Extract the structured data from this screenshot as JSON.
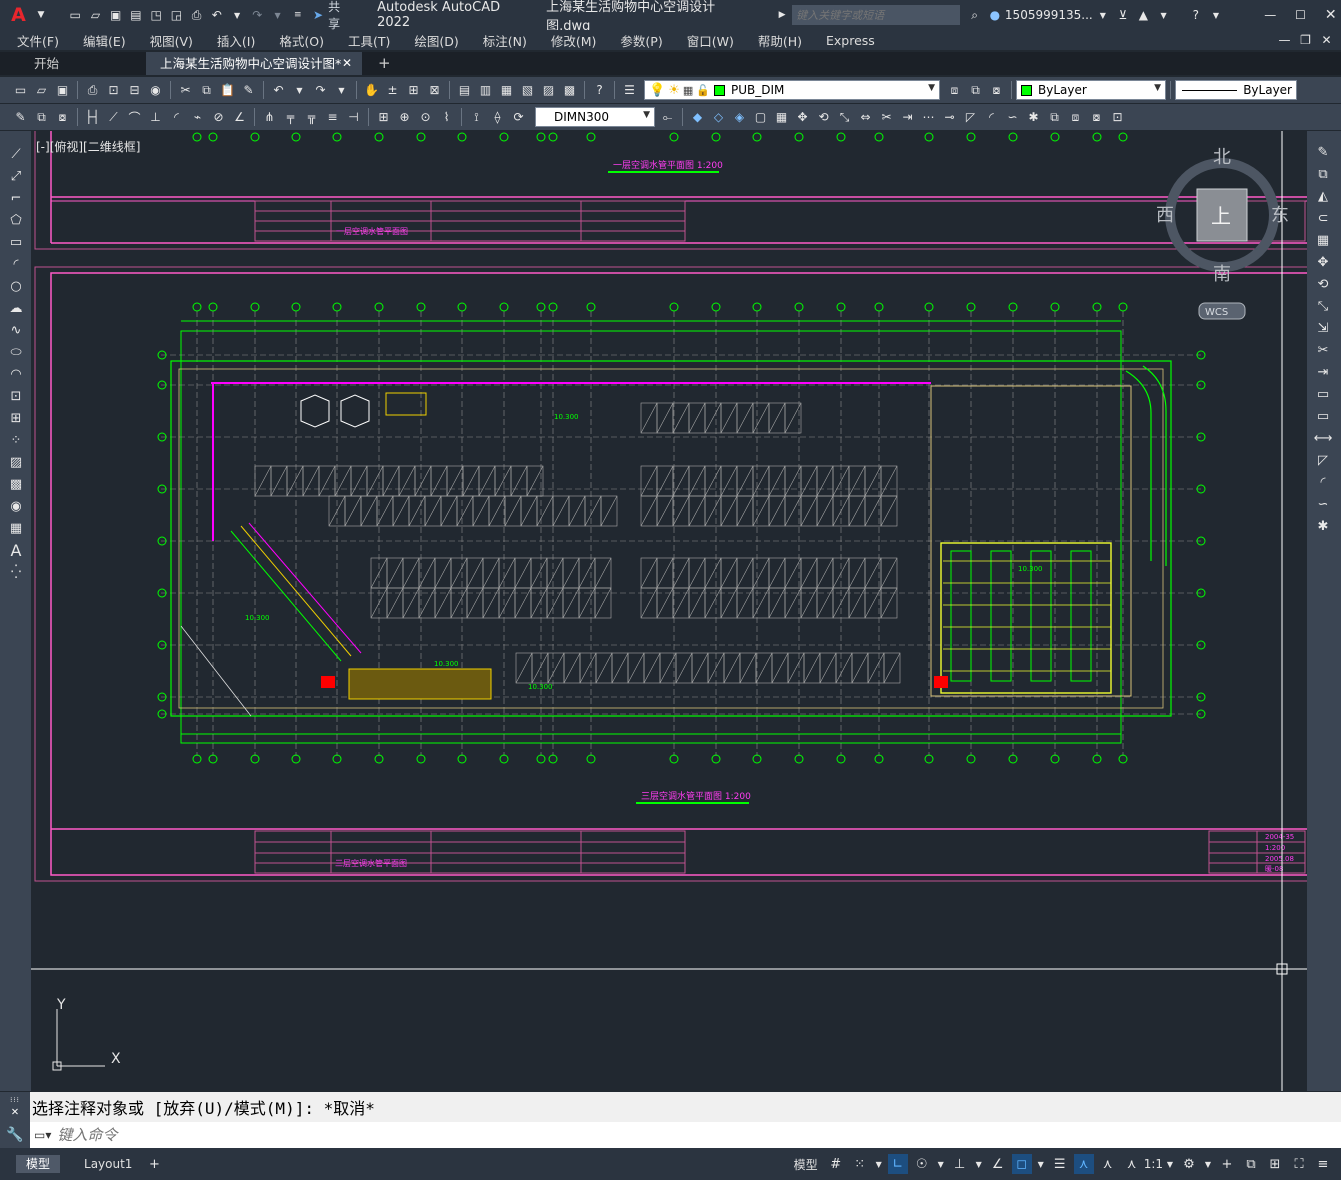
{
  "app": {
    "logo": "A",
    "title": "Autodesk AutoCAD 2022",
    "filename": "上海某生活购物中心空调设计图.dwg",
    "share_label": "共享",
    "search_placeholder": "键入关键字或短语",
    "user": "1505999135...",
    "colors": {
      "accent": "#c8102e",
      "title_bg": "#2b3440",
      "toolbar_bg": "#3b4553",
      "canvas_bg": "#212830",
      "layer_green": "#00ff00",
      "magenta": "#ff00ff"
    }
  },
  "menu": [
    "文件(F)",
    "编辑(E)",
    "视图(V)",
    "插入(I)",
    "格式(O)",
    "工具(T)",
    "绘图(D)",
    "标注(N)",
    "修改(M)",
    "参数(P)",
    "窗口(W)",
    "帮助(H)",
    "Express"
  ],
  "tabs": [
    {
      "label": "开始"
    },
    {
      "label": "上海某生活购物中心空调设计图*"
    }
  ],
  "toolbar": {
    "layer_name": "PUB_DIM",
    "color_value": "ByLayer",
    "linetype_value": "ByLayer",
    "dimstyle_value": "DIMN300"
  },
  "viewport": {
    "label": "[-][俯视][二维线框]",
    "compass": {
      "north": "北",
      "south": "南",
      "east": "东",
      "west": "西",
      "top": "上",
      "wcs": "WCS"
    },
    "ucs": {
      "x": "X",
      "y": "Y"
    }
  },
  "drawing": {
    "title_top": "一层空调水管平面图 1:200",
    "title_main": "三层空调水管平面图 1:200",
    "titleblock_top": "一层空调水管平面图",
    "titleblock_main": "三层空调水管平面图",
    "tb_right": [
      "2004-35",
      "1:200",
      "2005.08",
      "暖-08"
    ],
    "elevation_labels": [
      "10.300",
      "10.300",
      "10.300",
      "10.300",
      "10.300"
    ]
  },
  "command": {
    "history": "选择注释对象或 [放弃(U)/模式(M)]: *取消*",
    "placeholder": "键入命令"
  },
  "status": {
    "layout_tabs": [
      "模型",
      "Layout1"
    ],
    "model_label": "模型",
    "scale": "1:1"
  }
}
